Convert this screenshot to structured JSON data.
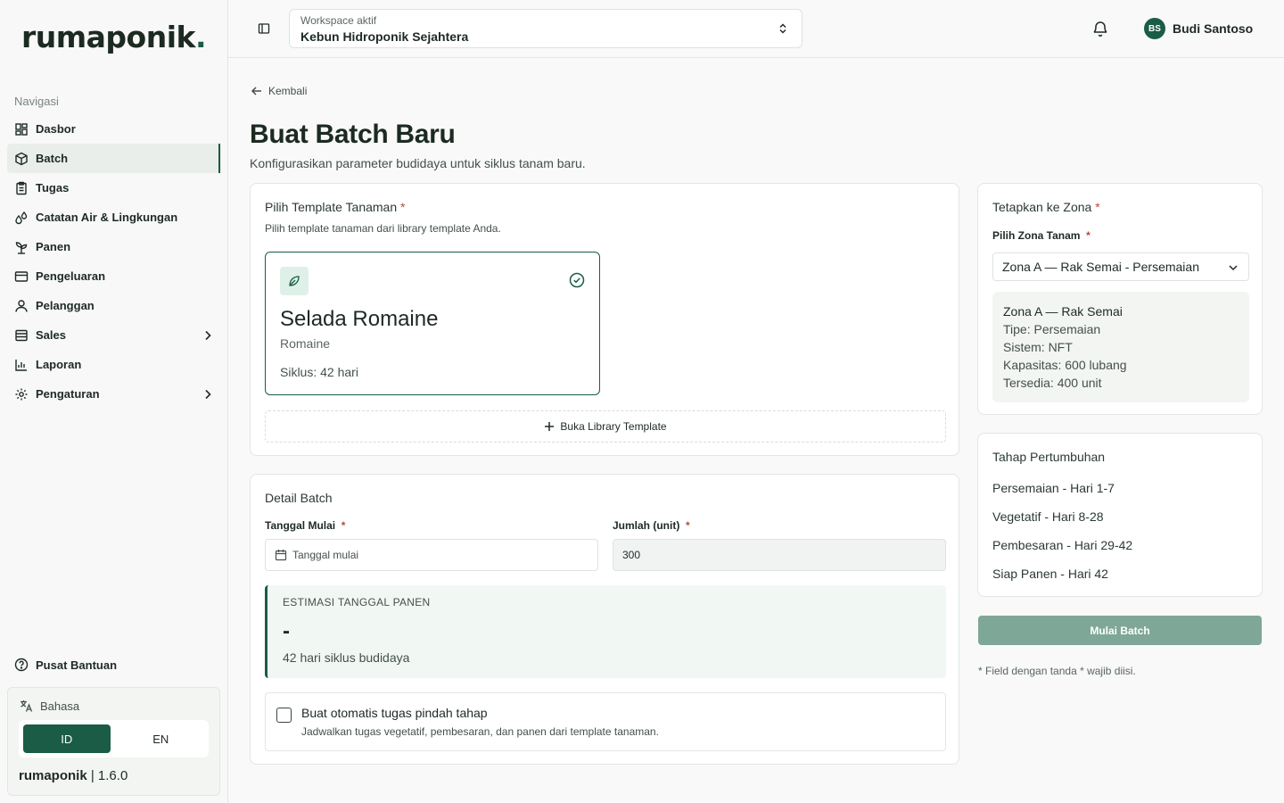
{
  "app": {
    "logo_text": "rumaponik",
    "logo_dot": ".",
    "version_name": "rumaponik",
    "version_number": "| 1.6.0"
  },
  "sidebar": {
    "heading": "Navigasi",
    "items": [
      {
        "label": "Dasbor",
        "icon": "dashboard-icon"
      },
      {
        "label": "Batch",
        "icon": "box-icon",
        "active": true
      },
      {
        "label": "Tugas",
        "icon": "clipboard-icon"
      },
      {
        "label": "Catatan Air & Lingkungan",
        "icon": "droplets-icon"
      },
      {
        "label": "Panen",
        "icon": "sprout-icon"
      },
      {
        "label": "Pengeluaran",
        "icon": "wallet-icon"
      },
      {
        "label": "Pelanggan",
        "icon": "user-icon"
      },
      {
        "label": "Sales",
        "icon": "receipt-icon",
        "has_children": true
      },
      {
        "label": "Laporan",
        "icon": "chart-icon"
      },
      {
        "label": "Pengaturan",
        "icon": "gear-icon",
        "has_children": true
      }
    ],
    "help_label": "Pusat Bantuan",
    "language": {
      "label": "Bahasa",
      "options": [
        "ID",
        "EN"
      ],
      "selected": "ID"
    }
  },
  "header": {
    "workspace_label": "Workspace aktif",
    "workspace_value": "Kebun Hidroponik Sejahtera",
    "user_initials": "BS",
    "user_name": "Budi Santoso"
  },
  "main": {
    "back_label": "Kembali",
    "title": "Buat Batch Baru",
    "subtitle": "Konfigurasikan parameter budidaya untuk siklus tanam baru.",
    "template_section": {
      "title": "Pilih Template Tanaman",
      "required_mark": "*",
      "description": "Pilih template tanaman dari library template Anda.",
      "selected_template": {
        "name": "Selada Romaine",
        "variety": "Romaine",
        "cycle": "Siklus: 42 hari"
      },
      "library_button": "Buka Library Template"
    },
    "detail_section": {
      "title": "Detail Batch",
      "start_date_label": "Tanggal Mulai",
      "start_date_placeholder": "Tanggal mulai",
      "quantity_label": "Jumlah (unit)",
      "quantity_value": "300",
      "required_mark": "*",
      "estimate_label": "ESTIMASI TANGGAL PANEN",
      "estimate_value": "-",
      "estimate_note": "42 hari siklus budidaya",
      "auto_task_title": "Buat otomatis tugas pindah tahap",
      "auto_task_desc": "Jadwalkan tugas vegetatif, pembesaran, dan panen dari template tanaman.",
      "auto_task_checked": false
    },
    "zone_section": {
      "title": "Tetapkan ke Zona",
      "required_mark": "*",
      "select_label": "Pilih Zona Tanam",
      "selected_zone": "Zona A — Rak Semai - Persemaian",
      "info": {
        "name": "Zona A — Rak Semai",
        "type": "Tipe: Persemaian",
        "system": "Sistem: NFT",
        "capacity": "Kapasitas: 600 lubang",
        "available": "Tersedia: 400 unit"
      }
    },
    "growth_section": {
      "title": "Tahap Pertumbuhan",
      "stages": [
        "Persemaian - Hari 1-7",
        "Vegetatif - Hari 8-28",
        "Pembesaran - Hari 29-42",
        "Siap Panen - Hari 42"
      ]
    },
    "start_button": "Mulai Batch",
    "footnote": "* Field dengan tanda * wajib diisi."
  },
  "colors": {
    "brand": "#1a5c45",
    "button_disabled": "#7fa797",
    "required": "#b94a3a"
  }
}
